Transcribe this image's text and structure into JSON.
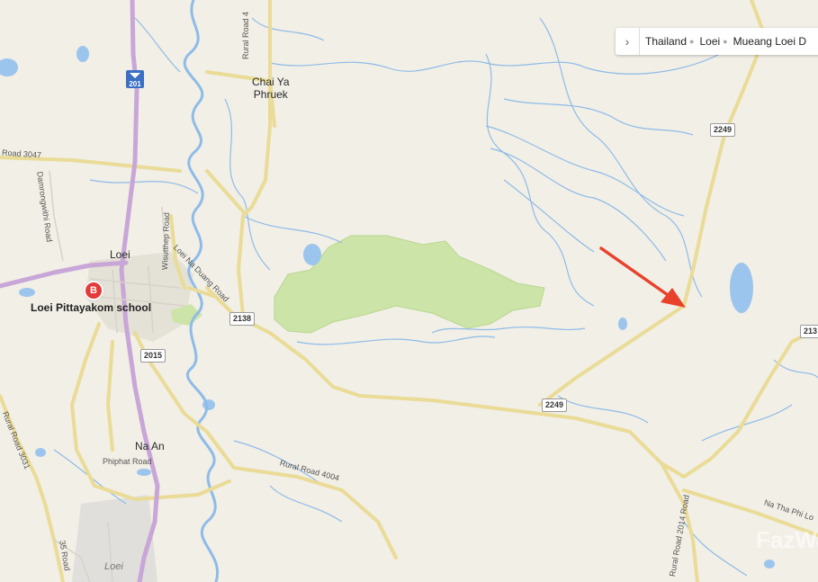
{
  "map": {
    "towns": {
      "loei": "Loei",
      "chai_ya_phruek": "Chai Ya\nPhruek",
      "na_an": "Na An"
    },
    "area_label": "Loei",
    "poi": {
      "marker_letter": "B",
      "name": "Loei Pittayakom school"
    },
    "roads": {
      "rural_road_4": "Rural Road 4",
      "road_3047": "Road 3047",
      "damrongwithi": "Damrongwithi Road",
      "wisutthep": "Wisutthep Road",
      "loei_na_duang": "Loei Na Duang Road",
      "rural_road_3031": "Rural Road 3031",
      "phiphat": "Phiphat Road",
      "rural_road_4004": "Rural Road 4004",
      "road_35": "35 Road",
      "na_tha_phi": "Na Tha Phi Lo",
      "rural_road_2014": "Rural Road 2014 Road"
    },
    "shields": {
      "s2249_top": "2249",
      "s2249_mid": "2249",
      "s2138": "2138",
      "s2015": "2015",
      "s213": "213"
    },
    "highway": {
      "number": "201"
    },
    "arrow_color": "#e8412c",
    "forest_color": "#cde4a8",
    "water_color": "#9cc5ee"
  },
  "breadcrumb": {
    "items": [
      "Thailand",
      "Loei",
      "Mueang Loei D"
    ]
  },
  "watermark": "FazWaz"
}
